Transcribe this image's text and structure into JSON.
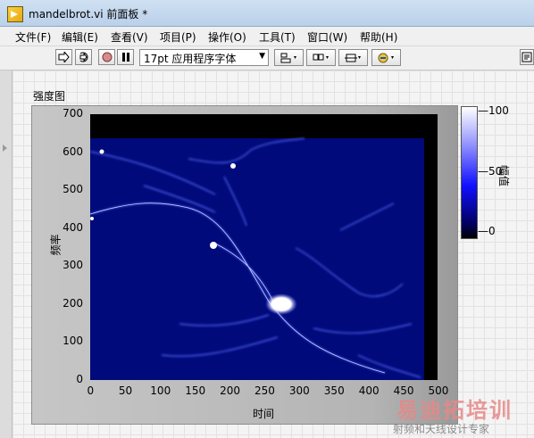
{
  "window": {
    "title": "mandelbrot.vi 前面板 *"
  },
  "menu": [
    "文件(F)",
    "编辑(E)",
    "查看(V)",
    "项目(P)",
    "操作(O)",
    "工具(T)",
    "窗口(W)",
    "帮助(H)"
  ],
  "toolbar": {
    "font": "17pt 应用程序字体",
    "buttons": [
      "run-arrow-icon",
      "run-continuously-icon",
      "abort-icon",
      "pause-icon"
    ],
    "dropdowns": [
      "align-objects-icon",
      "distribute-objects-icon",
      "resize-objects-icon",
      "reorder-icon"
    ]
  },
  "graph": {
    "label": "强度图",
    "chart_data": {
      "type": "heatmap",
      "xlabel": "时间",
      "ylabel": "频率",
      "zlabel": "幅值",
      "xlim": [
        0,
        500
      ],
      "ylim": [
        0,
        700
      ],
      "zlim": [
        0,
        100
      ],
      "x_ticks": [
        "0",
        "50",
        "100",
        "150",
        "200",
        "250",
        "300",
        "350",
        "400",
        "450",
        "500"
      ],
      "y_ticks": [
        "0",
        "100",
        "200",
        "300",
        "400",
        "500",
        "600",
        "700"
      ],
      "z_ticks": [
        "100",
        "50",
        "0"
      ],
      "colors": {
        "low": "#000000",
        "mid": "#0000ff",
        "high": "#ffffff"
      }
    }
  },
  "watermark": {
    "line1": "易迪拓培训",
    "line2": "射频和天线设计专家"
  }
}
